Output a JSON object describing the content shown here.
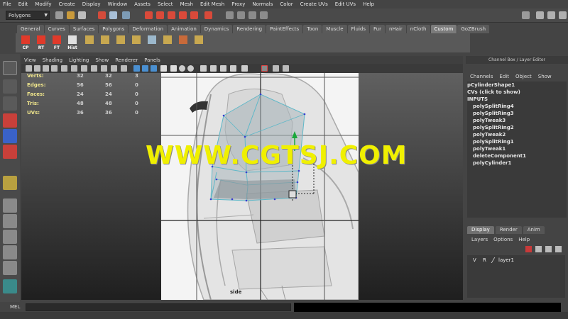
{
  "menubar": [
    "File",
    "Edit",
    "Modify",
    "Create",
    "Display",
    "Window",
    "Assets",
    "Select",
    "Mesh",
    "Edit Mesh",
    "Proxy",
    "Normals",
    "Color",
    "Create UVs",
    "Edit UVs",
    "Help"
  ],
  "status_line": {
    "mode": "Polygons"
  },
  "shelf_tabs": [
    "General",
    "Curves",
    "Surfaces",
    "Polygons",
    "Deformation",
    "Animation",
    "Dynamics",
    "Rendering",
    "PaintEffects",
    "Toon",
    "Muscle",
    "Fluids",
    "Fur",
    "nHair",
    "nCloth",
    "Custom",
    "GoZBrush"
  ],
  "shelf_active_tab": "Custom",
  "shelf_buttons": [
    "CP",
    "RT",
    "FT",
    "Hist"
  ],
  "viewport": {
    "menu": [
      "View",
      "Shading",
      "Lighting",
      "Show",
      "Renderer",
      "Panels"
    ],
    "hud": [
      {
        "label": "Verts:",
        "v1": "32",
        "v2": "32",
        "v3": "3"
      },
      {
        "label": "Edges:",
        "v1": "56",
        "v2": "56",
        "v3": "0"
      },
      {
        "label": "Faces:",
        "v1": "24",
        "v2": "24",
        "v3": "0"
      },
      {
        "label": "Tris:",
        "v1": "48",
        "v2": "48",
        "v3": "0"
      },
      {
        "label": "UVs:",
        "v1": "36",
        "v2": "36",
        "v3": "0"
      }
    ],
    "camera_label": "side"
  },
  "watermark": "WWW.CGTSJ.COM",
  "channel_box": {
    "title": "Channel Box / Layer Editor",
    "menu": [
      "Channels",
      "Edit",
      "Object",
      "Show"
    ],
    "items": [
      {
        "text": "pCylinderShape1",
        "indent": false
      },
      {
        "text": "CVs (click to show)",
        "indent": false
      },
      {
        "text": "INPUTS",
        "indent": false
      },
      {
        "text": "polySplitRing4",
        "indent": true
      },
      {
        "text": "polySplitRing3",
        "indent": true
      },
      {
        "text": "polyTweak3",
        "indent": true
      },
      {
        "text": "polySplitRing2",
        "indent": true
      },
      {
        "text": "polyTweak2",
        "indent": true
      },
      {
        "text": "polySplitRing1",
        "indent": true
      },
      {
        "text": "polyTweak1",
        "indent": true
      },
      {
        "text": "deleteComponent1",
        "indent": true
      },
      {
        "text": "polyCylinder1",
        "indent": true
      }
    ]
  },
  "layer_editor": {
    "tabs": [
      "Display",
      "Render",
      "Anim"
    ],
    "active_tab": "Display",
    "menu": [
      "Layers",
      "Options",
      "Help"
    ],
    "layers": [
      {
        "v": "V",
        "r": "R",
        "name": "layer1"
      }
    ]
  },
  "command_line": {
    "label": "MEL"
  },
  "colors": {
    "watermark": "#f0f000",
    "hud_label": "#f0e68c",
    "wireframe": "#5fb8c8",
    "active_tab": "#7b7b7b"
  }
}
